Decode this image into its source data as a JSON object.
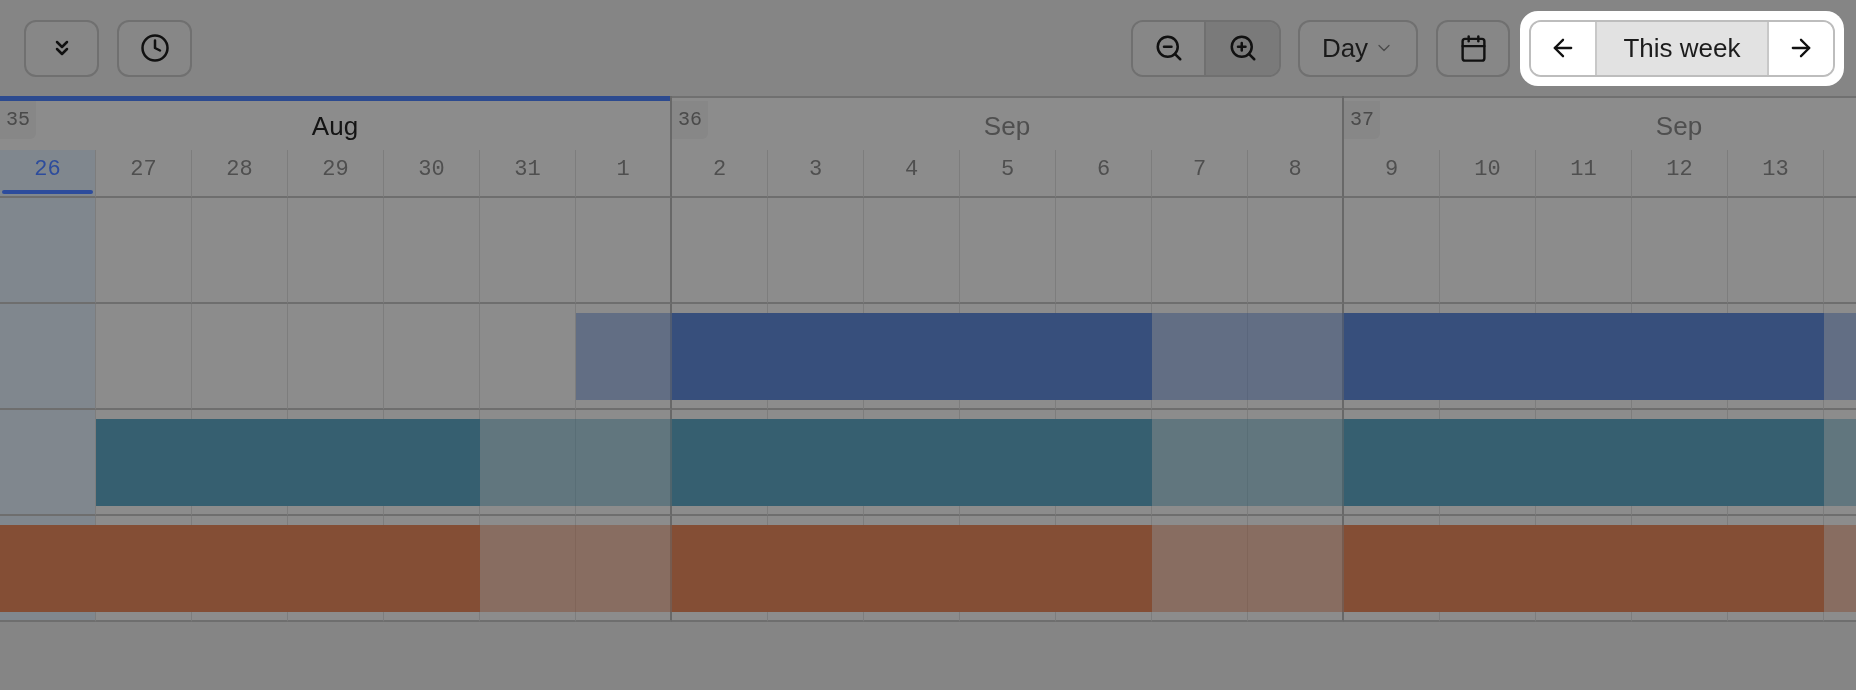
{
  "toolbar": {
    "zoom_buttons": [
      {
        "pressed": false
      },
      {
        "pressed": true
      }
    ],
    "view_select": {
      "value": "Day"
    },
    "week_nav": {
      "label": "This week",
      "spotlight": true
    }
  },
  "timeline": {
    "weeks": [
      {
        "number": "35",
        "month": "Aug",
        "current": true,
        "days": [
          {
            "label": "26",
            "today": true,
            "weekend": false
          },
          {
            "label": "27",
            "today": false,
            "weekend": false
          },
          {
            "label": "28",
            "today": false,
            "weekend": false
          },
          {
            "label": "29",
            "today": false,
            "weekend": false
          },
          {
            "label": "30",
            "today": false,
            "weekend": false
          },
          {
            "label": "31",
            "today": false,
            "weekend": true
          },
          {
            "label": "1",
            "today": false,
            "weekend": true
          }
        ]
      },
      {
        "number": "36",
        "month": "Sep",
        "current": false,
        "days": [
          {
            "label": "2",
            "today": false,
            "weekend": false
          },
          {
            "label": "3",
            "today": false,
            "weekend": false
          },
          {
            "label": "4",
            "today": false,
            "weekend": false
          },
          {
            "label": "5",
            "today": false,
            "weekend": false
          },
          {
            "label": "6",
            "today": false,
            "weekend": false
          },
          {
            "label": "7",
            "today": false,
            "weekend": true
          },
          {
            "label": "8",
            "today": false,
            "weekend": true
          }
        ]
      },
      {
        "number": "37",
        "month": "Sep",
        "current": false,
        "days": [
          {
            "label": "9",
            "today": false,
            "weekend": false
          },
          {
            "label": "10",
            "today": false,
            "weekend": false
          },
          {
            "label": "11",
            "today": false,
            "weekend": false
          },
          {
            "label": "12",
            "today": false,
            "weekend": false
          },
          {
            "label": "13",
            "today": false,
            "weekend": false
          },
          {
            "today": false,
            "weekend": true
          }
        ]
      }
    ]
  },
  "rows": [
    {
      "filled": [
        false,
        false,
        false,
        false,
        false,
        false,
        false,
        false,
        false,
        false,
        false,
        false,
        false,
        false,
        false,
        false,
        false,
        false,
        false,
        false
      ]
    },
    {
      "color": "#374f7c",
      "filled": [
        false,
        false,
        false,
        false,
        false,
        false,
        true,
        true,
        true,
        true,
        true,
        true,
        true,
        true,
        true,
        true,
        true,
        true,
        true,
        true
      ]
    },
    {
      "color": "#365f70",
      "filled": [
        false,
        true,
        true,
        true,
        true,
        true,
        true,
        true,
        true,
        true,
        true,
        true,
        true,
        true,
        true,
        true,
        true,
        true,
        true,
        true
      ]
    },
    {
      "color": "#844e35",
      "filled": [
        true,
        true,
        true,
        true,
        true,
        true,
        true,
        true,
        true,
        true,
        true,
        true,
        true,
        true,
        true,
        true,
        true,
        true,
        true,
        true
      ]
    }
  ]
}
